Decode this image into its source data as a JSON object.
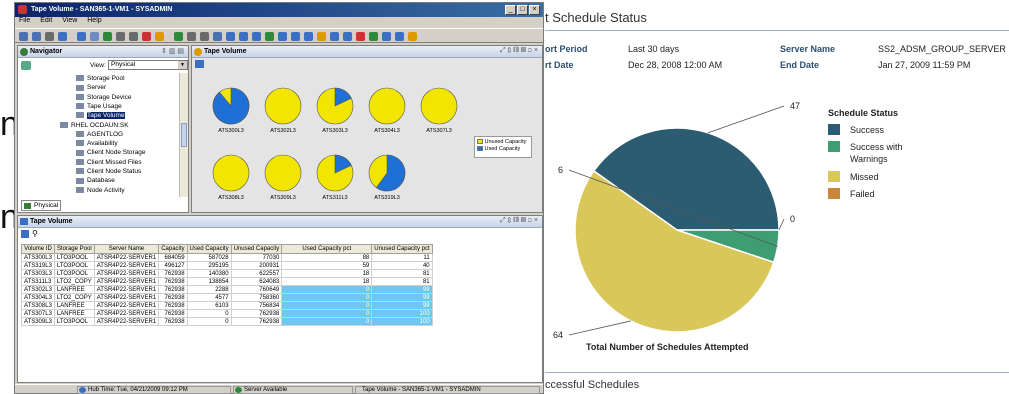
{
  "slide_stub": {
    "line1": "n",
    "line2": "n"
  },
  "window": {
    "title": "Tape Volume - SAN365-1-VM1 - SYSADMIN",
    "menu": [
      "File",
      "Edit",
      "View",
      "Help"
    ]
  },
  "navigator": {
    "title": "Navigator",
    "view_label": "View:",
    "view_value": "Physical",
    "tree": [
      {
        "label": "Storage Pool"
      },
      {
        "label": "Server"
      },
      {
        "label": "Storage Device"
      },
      {
        "label": "Tape Usage"
      },
      {
        "label": "Tape Volume",
        "selected": true
      },
      {
        "label": "RHEL OCDAUN:SK"
      },
      {
        "label": "AGENTLOG"
      },
      {
        "label": "Availability"
      },
      {
        "label": "Client Node Storage"
      },
      {
        "label": "Client Missed Files"
      },
      {
        "label": "Client Node Status"
      },
      {
        "label": "Database"
      },
      {
        "label": "Node Activity"
      }
    ],
    "tab": "Physical"
  },
  "tape_chart": {
    "title": "Tape Volume",
    "legend": [
      "Unused Capacity",
      "Used Capacity"
    ],
    "colors": {
      "unused": "#f2e600",
      "used": "#1e6fd6"
    },
    "tapes": [
      {
        "label": "ATS300L3",
        "used_fraction": 0.89
      },
      {
        "label": "ATS302L3",
        "used_fraction": 0.0
      },
      {
        "label": "ATS303L3",
        "used_fraction": 0.18
      },
      {
        "label": "ATS304L3",
        "used_fraction": 0.0
      },
      {
        "label": "ATS307L3",
        "used_fraction": 0.0
      },
      {
        "label": "ATS308L3",
        "used_fraction": 0.0
      },
      {
        "label": "ATS309L3",
        "used_fraction": 0.0
      },
      {
        "label": "ATS311L3",
        "used_fraction": 0.18
      },
      {
        "label": "ATS319L3",
        "used_fraction": 0.6
      }
    ]
  },
  "table_panel": {
    "title": "Tape Volume",
    "columns": [
      "Volume ID",
      "Storage Pool",
      "Server Name",
      "Capacity",
      "Used Capacity",
      "Unused Capacity",
      "Used Capacity pct",
      "Unused Capacity pct"
    ],
    "rows": [
      [
        "ATS300L3",
        "LTO3POOL",
        "ATSR4P22-SERVER1",
        "684059",
        "587028",
        "77030",
        "88",
        "11"
      ],
      [
        "ATS319L3",
        "LTO3POOL",
        "ATSR4P22-SERVER1",
        "496127",
        "295195",
        "200931",
        "59",
        "40"
      ],
      [
        "ATS303L3",
        "LTO3POOL",
        "ATSR4P22-SERVER1",
        "762938",
        "140380",
        "622557",
        "18",
        "81"
      ],
      [
        "ATS311L3",
        "LTO2_COPY",
        "ATSR4P22-SERVER1",
        "762938",
        "138854",
        "624083",
        "18",
        "81"
      ],
      [
        "ATS302L3",
        "LANFREE",
        "ATSR4P22-SERVER1",
        "762938",
        "2288",
        "760649",
        "0",
        "99"
      ],
      [
        "ATS304L3",
        "LTO2_COPY",
        "ATSR4P22-SERVER1",
        "762938",
        "4577",
        "758360",
        "0",
        "99"
      ],
      [
        "ATS308L3",
        "LANFREE",
        "ATSR4P22-SERVER1",
        "762938",
        "6103",
        "756834",
        "0",
        "99"
      ],
      [
        "ATS307L3",
        "LANFREE",
        "ATSR4P22-SERVER1",
        "762938",
        "0",
        "762938",
        "0",
        "100"
      ],
      [
        "ATS309L3",
        "LTO3POOL",
        "ATSR4P22-SERVER1",
        "762938",
        "0",
        "762938",
        "0",
        "100"
      ]
    ]
  },
  "statusbar": {
    "hub_time": "Hub Time: Tue, 04/21/2009 09:12 PM",
    "server": "Server Available",
    "workspace": "Tape Volume - SAN365-1-VM1 - SYSADMIN"
  },
  "report": {
    "title": "t Schedule Status",
    "period_label": "ort Period",
    "period_value": "Last 30 days",
    "start_label": "rt Date",
    "start_value": "Dec 28, 2008 12:00 AM",
    "server_label": "Server Name",
    "server_value": "SS2_ADSM_GROUP_SERVER",
    "end_label": "End Date",
    "end_value": "Jan 27, 2009 11:59 PM",
    "footer": "ccessful Schedules"
  },
  "chart_data": {
    "type": "pie",
    "title": "",
    "xlabel": "Total Number of Schedules Attempted",
    "legend_title": "Schedule Status",
    "legend_position": "right",
    "slices": [
      {
        "name": "Success",
        "value": 47,
        "color": "#2b5c72"
      },
      {
        "name": "Success with Warnings",
        "value": 6,
        "color": "#3e9e72"
      },
      {
        "name": "Missed",
        "value": 64,
        "color": "#d9c75a"
      },
      {
        "name": "Failed",
        "value": 0,
        "color": "#c8873a"
      }
    ],
    "data_labels": [
      "47",
      "6",
      "0",
      "64"
    ]
  }
}
